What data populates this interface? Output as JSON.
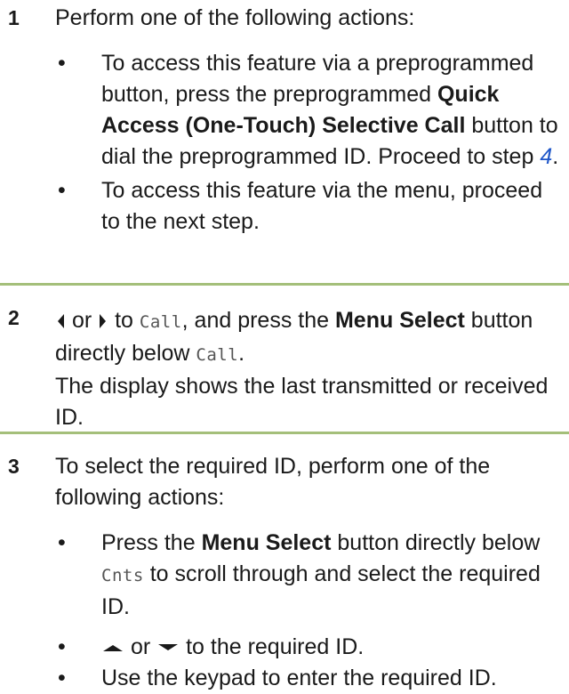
{
  "step1": {
    "number": "1",
    "intro": "Perform one of the following actions:",
    "bullet_char": "•",
    "bullet1": {
      "pre": "To access this feature via a preprogrammed button, press the preprogrammed ",
      "bold": "Quick Access (One-Touch) Selective Call",
      "mid": " button to dial the preprogrammed ID. Proceed to step ",
      "link": "4",
      "post": "."
    },
    "bullet2": "To access this feature via the menu, proceed to the next step."
  },
  "step2": {
    "number": "2",
    "or": "or",
    "to": " to ",
    "menu_item": "Call",
    "and_press": ", and press the ",
    "bold": "Menu Select",
    "button_below": " button directly below ",
    "menu_item2": "Call",
    "period": ".",
    "line2": "The display shows the last transmitted or received ID."
  },
  "step3": {
    "number": "3",
    "intro": "To select the required ID, perform one of the following actions:",
    "bullet1": {
      "pre": "Press the ",
      "bold": "Menu Select",
      "mid": " button directly below",
      "menu_item": "Cnts",
      "post": " to scroll through and select the required ID."
    },
    "bullet2": {
      "or": "or",
      "post": " to the required ID."
    },
    "bullet3": "Use the keypad to enter the required ID."
  },
  "colors": {
    "rule": "#a4bf7a",
    "link": "#1f57c9"
  },
  "icons": [
    "left-arrow-icon",
    "right-arrow-icon",
    "up-arrow-icon",
    "down-arrow-icon"
  ]
}
